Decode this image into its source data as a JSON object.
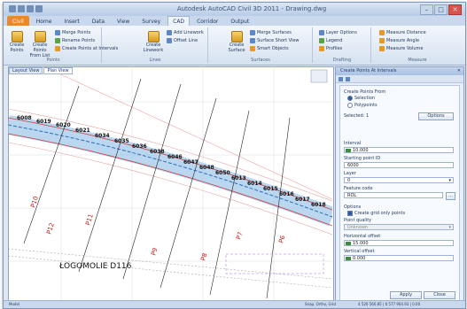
{
  "window": {
    "title": "Autodesk AutoCAD Civil 3D 2011 - Drawing.dwg",
    "controls": [
      "–",
      "□",
      "✕"
    ]
  },
  "ribbon": {
    "tabs": [
      "Home",
      "Insert",
      "Data",
      "View",
      "Survey",
      "CAD",
      "Corridor",
      "Output"
    ],
    "app_tab": "Civil",
    "active_tab": "CAD",
    "groups": [
      {
        "name": "Points",
        "big": [
          "Create Points",
          "Create Points From List"
        ],
        "small": [
          "Merge Points",
          "Rename Points",
          "Create Points at Intervals"
        ]
      },
      {
        "name": "Lines",
        "big": [
          "Create Linework"
        ],
        "small": [
          "Add Linework",
          "Offset Line"
        ]
      },
      {
        "name": "Surfaces",
        "big": [
          "Create Surface"
        ],
        "small": [
          "Merge Surfaces",
          "Surface Short View",
          "Smart Objects"
        ]
      },
      {
        "name": "Drafting",
        "small": [
          "Layer Options",
          "Legend",
          "Profiles"
        ]
      },
      {
        "name": "Measure",
        "small": [
          "Measure Distance",
          "Measure Angle",
          "Measure Volume"
        ]
      }
    ]
  },
  "drawing": {
    "tabs": [
      "Layout View",
      "Plan View"
    ],
    "active_tab": "Plan View",
    "point_labels": [
      "6008",
      "6019",
      "6020",
      "6021",
      "6034",
      "6035",
      "6036",
      "6038",
      "6046",
      "6047",
      "6048",
      "6050",
      "6013",
      "6014",
      "6015",
      "6016",
      "6017",
      "6018"
    ],
    "station_labels": [
      "P10",
      "P11",
      "P12",
      "P9",
      "P8",
      "P7",
      "P6"
    ],
    "road_name": "ŁOGOMOLIE D116"
  },
  "panel": {
    "title": "Create Points At Intervals",
    "section": "Create Points From",
    "radios": [
      {
        "label": "Selection",
        "checked": true
      },
      {
        "label": "Polypoints",
        "checked": false
      }
    ],
    "selected_label": "Selected: 1",
    "options_button": "Options",
    "interval_label": "Interval",
    "interval_value": "10.000",
    "startpoint_label": "Starting point ID",
    "startpoint_value": "6000",
    "layer_label": "Layer",
    "layer_value": "0",
    "feature_label": "Feature code",
    "feature_value": "ROL",
    "options_label": "Options",
    "checkbox_label": "Create grid only points",
    "pointquality_label": "Point quality",
    "pointquality_value": "Unknown",
    "horizontal_offset_label": "Horizontal offset",
    "horizontal_offset_value": "15.000",
    "vertical_offset_label": "Vertical offset",
    "vertical_offset_value": "0.000",
    "apply_button": "Apply",
    "close_button": "Close"
  },
  "statusbar": {
    "left": "Model",
    "coords": "Snap, Ortho, Grid",
    "right": "4 520 560.85 | 6 577 904.93 | 0.00"
  }
}
